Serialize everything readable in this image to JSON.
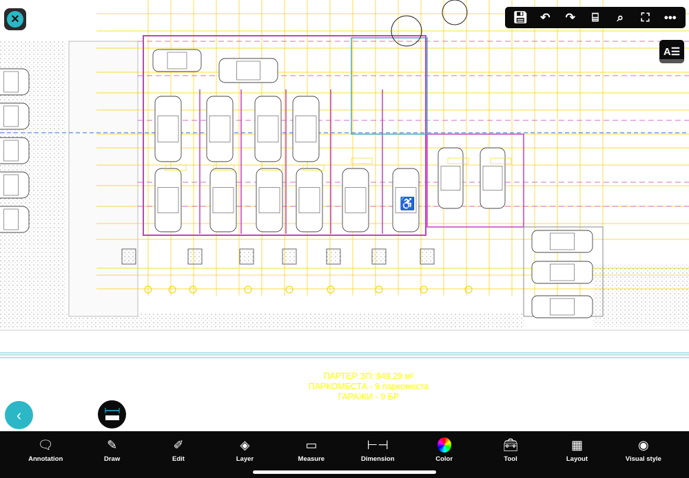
{
  "colors": {
    "accent": "#2bb7c6",
    "bar": "#0b0b0b",
    "caption": "#ffff00",
    "cad_yellow": "#f5d000",
    "cad_magenta": "#c040c0",
    "cad_blue": "#2a6ad8"
  },
  "top_toolbar": [
    {
      "name": "save-icon",
      "glyph": "💾︎"
    },
    {
      "name": "undo-icon",
      "glyph": "↶"
    },
    {
      "name": "redo-icon",
      "glyph": "↷"
    },
    {
      "name": "section-icon",
      "glyph": "⌸"
    },
    {
      "name": "zoom-extents-icon",
      "glyph": "⌕"
    },
    {
      "name": "fullscreen-icon",
      "glyph": "⛶"
    },
    {
      "name": "more-icon",
      "glyph": "•••"
    }
  ],
  "text_style_button": "A☰",
  "close_glyph": "✕",
  "back_glyph": "‹",
  "caption": {
    "line1": "ПАРТЕР  ЗП: 949.29 м²",
    "line2": "ПАРКОМЕСТА - 9  паркоместа",
    "line3": "ГАРАЖИ - 9 БР"
  },
  "bottom_toolbar": [
    {
      "label": "Annotation",
      "icon": "annotation-icon",
      "glyph": "🗨︎"
    },
    {
      "label": "Draw",
      "icon": "pencil-icon",
      "glyph": "✎"
    },
    {
      "label": "Edit",
      "icon": "edit-icon",
      "glyph": "✐"
    },
    {
      "label": "Layer",
      "icon": "layers-icon",
      "glyph": "◈"
    },
    {
      "label": "Measure",
      "icon": "ruler-icon",
      "glyph": "▭"
    },
    {
      "label": "Dimension",
      "icon": "dimension-icon",
      "glyph": "⊢⊣"
    },
    {
      "label": "Color",
      "icon": "color-wheel-icon",
      "glyph": "●"
    },
    {
      "label": "Tool",
      "icon": "toolbox-icon",
      "glyph": "🧰︎"
    },
    {
      "label": "Layout",
      "icon": "layout-icon",
      "glyph": "▦"
    },
    {
      "label": "Visual style",
      "icon": "visual-style-icon",
      "glyph": "◉"
    }
  ]
}
